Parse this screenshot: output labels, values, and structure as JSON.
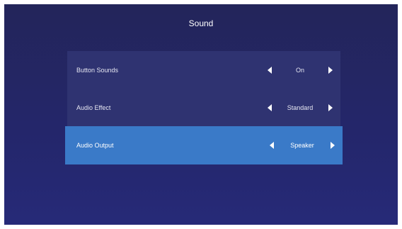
{
  "header": {
    "title": "Sound"
  },
  "settings": [
    {
      "label": "Button Sounds",
      "value": "On"
    },
    {
      "label": "Audio Effect",
      "value": "Standard"
    },
    {
      "label": "Audio Output",
      "value": "Speaker"
    }
  ],
  "selected_index": 2,
  "colors": {
    "background": "#24266a",
    "row": "#2f3371",
    "selected_row": "#3a7ac8",
    "text": "#ffffff"
  },
  "icons": {
    "previous": "triangle-left-icon",
    "next": "triangle-right-icon"
  }
}
